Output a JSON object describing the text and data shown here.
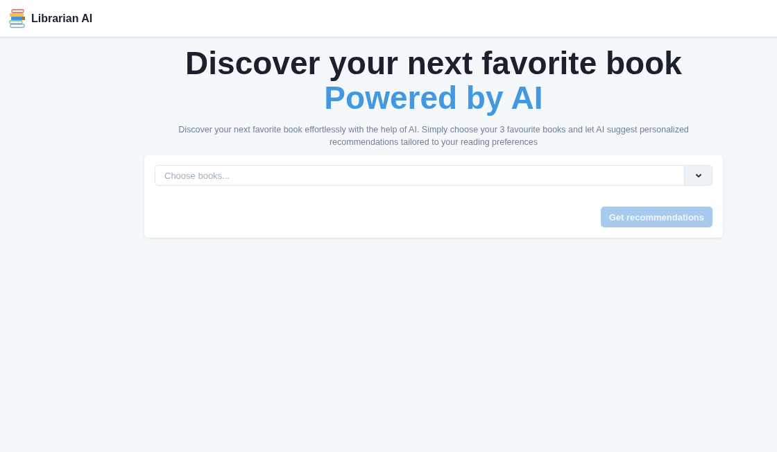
{
  "header": {
    "app_name": "Librarian AI"
  },
  "hero": {
    "title": "Discover your next favorite book",
    "subtitle": "Powered by AI",
    "description": "Discover your next favorite book effortlessly with the help of AI. Simply choose your 3 favourite books and let AI suggest personalized recommendations tailored to your reading preferences"
  },
  "form": {
    "select": {
      "placeholder": "Choose books..."
    },
    "submit": {
      "label": "Get recommendations",
      "disabled": true
    }
  }
}
